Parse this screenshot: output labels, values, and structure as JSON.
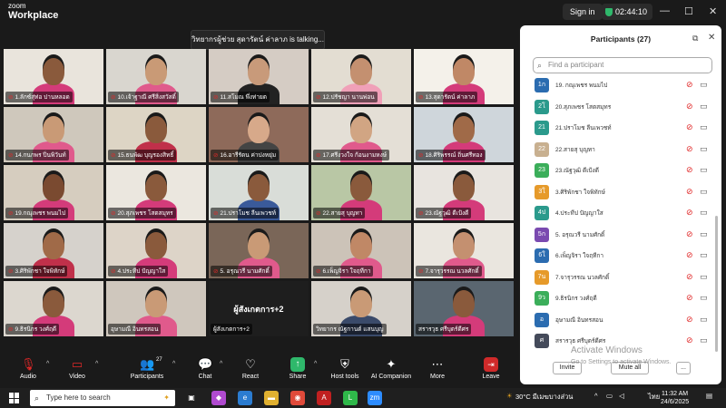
{
  "app": {
    "brand_top": "zoom",
    "brand_name": "Workplace"
  },
  "header": {
    "signin_label": "Sign in",
    "timer": "02:44:10"
  },
  "window_controls": [
    "—",
    "☐",
    "✕"
  ],
  "talking_banner": "วิทยากรผู้ช่วย สุดารัตน์ ค่าลาภ is talking...",
  "tiles": [
    {
      "name": "1.ลักซ์สุ่ท่อ ปานหลอด",
      "muted": true,
      "bg": "#e9e4dc",
      "skin": "#8a5a3c",
      "shirt": "#d43b7a"
    },
    {
      "name": "10.เจ้าฐาณี ศรีสิ่งสวัสดิ์",
      "muted": true,
      "bg": "#d9d6cf",
      "skin": "#c99a76",
      "shirt": "#e05a8c"
    },
    {
      "name": "11.สโมณ พึ่งท่ายต",
      "muted": true,
      "bg": "#d5ccc4",
      "skin": "#c89a7a",
      "shirt": "#222222"
    },
    {
      "name": "12.ปรัชญา นานพ่อน",
      "muted": true,
      "bg": "#e3ddd2",
      "skin": "#c49070",
      "shirt": "#f0a0b8"
    },
    {
      "name": "13.สุดารัตน์ ค่าลาภ",
      "muted": true,
      "bg": "#f4f1ea",
      "skin": "#c08866",
      "shirt": "#d43b7a"
    },
    {
      "name": "14.กนกพร ปิ่นพิวันท์",
      "muted": true,
      "bg": "#cfc8bc",
      "skin": "#c99a76",
      "shirt": "#e05a8c"
    },
    {
      "name": "15.ธนพัฒ บุญรองสิทธิ์",
      "muted": true,
      "bg": "#ddd5c5",
      "skin": "#8a5a3c",
      "shirt": "#c0304a"
    },
    {
      "name": "16.อารีรัดน ค่าปงหยุ่ม",
      "muted": true,
      "bg": "#8e6a5a",
      "skin": "#d7a98a",
      "shirt": "#444444"
    },
    {
      "name": "17.ศรีงวงใจ ก้อนงามหงษ์",
      "muted": true,
      "bg": "#e4dfd6",
      "skin": "#d1a583",
      "shirt": "#e05a8c"
    },
    {
      "name": "18.ศิริพรรณ์ ถิ่นศรีทอง",
      "muted": true,
      "bg": "#cfd6db",
      "skin": "#a06a48",
      "shirt": "#d43b7a"
    },
    {
      "name": "19.กณุเพชร พนมไป",
      "muted": true,
      "bg": "#d6cdbf",
      "skin": "#7a4a30",
      "shirt": "#d43b7a"
    },
    {
      "name": "20.สุภเพชร โสตสมุทร",
      "muted": true,
      "bg": "#ebe7df",
      "skin": "#8a5a3c",
      "shirt": "#d43b7a"
    },
    {
      "name": "21.ปราโมช ลีนเพวชท์",
      "muted": true,
      "bg": "#d9ddd8",
      "skin": "#8a5a3c",
      "shirt": "#3a5a9a"
    },
    {
      "name": "22.สายสุ บุญทา",
      "muted": true,
      "bg": "#b9c7a5",
      "skin": "#8a5a3c",
      "shirt": "#d43b7a"
    },
    {
      "name": "23.ณัฐวุฒิ ดีเป้งดี",
      "muted": true,
      "bg": "#e8e4df",
      "skin": "#8a5a3c",
      "shirt": "#d43b7a"
    },
    {
      "name": "3.ศิริพักชา ใจพิทักษ์",
      "muted": true,
      "bg": "#d6d2cc",
      "skin": "#a06a48",
      "shirt": "#c0304a"
    },
    {
      "name": "4.ประทีป ปัญญาใส",
      "muted": true,
      "bg": "#ddd4c8",
      "skin": "#8a5a3c",
      "shirt": "#d43b7a"
    },
    {
      "name": "5. อรุณวรี นามศักดิ์",
      "muted": true,
      "bg": "#7a6658",
      "skin": "#c99a76",
      "shirt": "#e05a8c"
    },
    {
      "name": "6.เพ็ญจิรา ใจฤทีกา",
      "muted": true,
      "bg": "#ccc3b8",
      "skin": "#c08866",
      "shirt": "#e05a8c"
    },
    {
      "name": "7.จารุวรรณ นวลศักดิ์",
      "muted": true,
      "bg": "#eae6df",
      "skin": "#c49070",
      "shirt": "#e05a8c"
    },
    {
      "name": "9.ธิรนิกร วงศ์ฤดี",
      "muted": true,
      "bg": "#dcd7cf",
      "skin": "#8a5a3c",
      "shirt": "#d43b7a"
    },
    {
      "name": "อุษามณี อินทรสอน",
      "muted": false,
      "bg": "#cfc7bd",
      "skin": "#c99a76",
      "shirt": "#e05a8c"
    },
    {
      "name": "ผู้สังเกตการ+2",
      "muted": false,
      "bg": "",
      "skin": "",
      "shirt": "",
      "big_label": "ผู้สังเกตการ+2",
      "textonly": true
    },
    {
      "name": "วิทยากร ณัฐกานต์ แสนบุญ",
      "muted": false,
      "bg": "#d6d1ca",
      "skin": "#c99a76",
      "shirt": "#3a4a6a"
    },
    {
      "name": "สรารวุธ ศรีบุตร์ดีศร",
      "muted": false,
      "bg": "#5a6670",
      "skin": "#8a5a3c",
      "shirt": "#d43b7a"
    }
  ],
  "toolbar": {
    "audio": "Audio",
    "video": "Video",
    "participants": "Participants",
    "participants_count": "27",
    "chat": "Chat",
    "react": "React",
    "share": "Share",
    "host_tools": "Host tools",
    "ai_companion": "AI Companion",
    "more": "More",
    "leave": "Leave"
  },
  "panel": {
    "title": "Participants (27)",
    "search_placeholder": "Find a participant",
    "invite": "Invite",
    "mute_all": "Mute all",
    "more": "...",
    "participants": [
      {
        "initials": "1ก",
        "name": "19. กณุเพชร พนมไป",
        "color": "#2b6cb0"
      },
      {
        "initials": "2โ",
        "name": "20.สุภเพชร โสตสมุทร",
        "color": "#2b9a8c"
      },
      {
        "initials": "21",
        "name": "21.ปราโมช ลีนเพวชท์",
        "color": "#2b9a8c"
      },
      {
        "initials": "22",
        "name": "22.สายสุ บุญทา",
        "color": "#c8b090"
      },
      {
        "initials": "23",
        "name": "23.ณัฐวุฒิ ดีเป้งดี",
        "color": "#3bae5a"
      },
      {
        "initials": "3ใ",
        "name": "3.ศิริพักชา ใจพิทักษ์",
        "color": "#e69a2a"
      },
      {
        "initials": "4ป",
        "name": "4.ประทีป ปัญญาใส",
        "color": "#2b9a8c"
      },
      {
        "initials": "5ก",
        "name": "5. อรุณวรี นามศักดิ์",
        "color": "#7a4ab0"
      },
      {
        "initials": "6ใ",
        "name": "6.เพ็ญจิรา ใจฤทีกา",
        "color": "#2b6cb0"
      },
      {
        "initials": "7น",
        "name": "7.จารุวรรณ นวลศักดิ์",
        "color": "#e69a2a"
      },
      {
        "initials": "9ว",
        "name": "9.ธิรนิกร วงศ์ฤดี",
        "color": "#3bae5a"
      },
      {
        "initials": "อ",
        "name": "อุษามณี อินทรสอน",
        "color": "#2b6cb0"
      },
      {
        "initials": "ศ",
        "name": "สรารวุธ ศรีบุตร์ดีศร",
        "color": "#444a5a"
      }
    ]
  },
  "watermark": {
    "line1": "Activate Windows",
    "line2": "Go to Settings to activate Windows."
  },
  "taskbar": {
    "search_placeholder": "Type here to search",
    "weather": "30°C มีเมฆบางส่วน",
    "lang": "ไทย",
    "time": "11:32 AM",
    "date": "24/6/2025"
  }
}
